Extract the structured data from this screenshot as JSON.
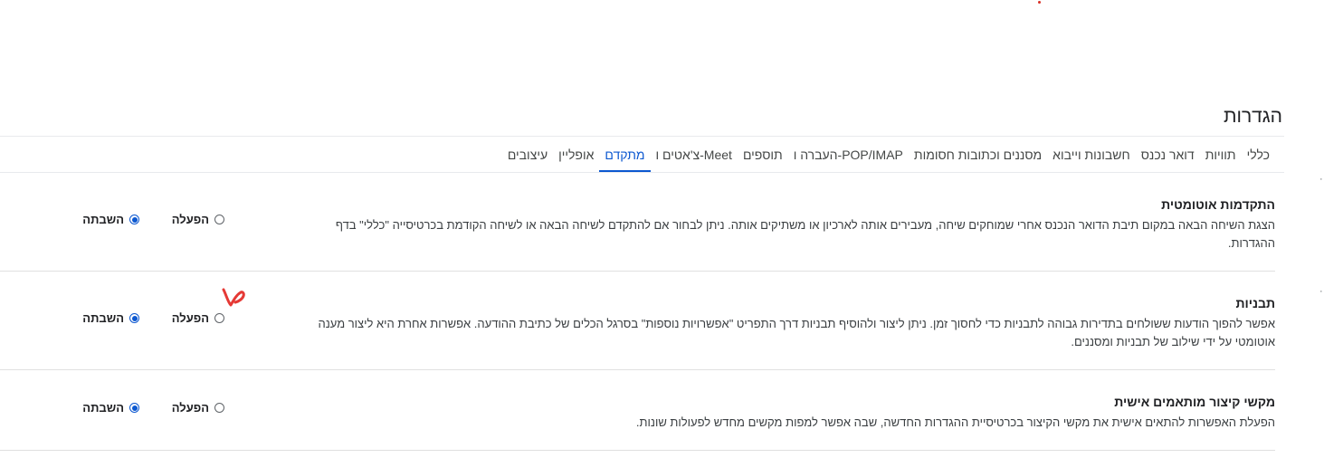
{
  "page": {
    "title": "הגדרות"
  },
  "tabs": [
    {
      "label": "כללי",
      "selected": false
    },
    {
      "label": "תוויות",
      "selected": false
    },
    {
      "label": "דואר נכנס",
      "selected": false
    },
    {
      "label": "חשבונות וייבוא",
      "selected": false
    },
    {
      "label": "מסננים וכתובות חסומות",
      "selected": false
    },
    {
      "label": "העברה ו-POP/IMAP",
      "selected": false
    },
    {
      "label": "תוספים",
      "selected": false
    },
    {
      "label": "צ'אטים ו-Meet",
      "selected": false
    },
    {
      "label": "מתקדם",
      "selected": true
    },
    {
      "label": "אופליין",
      "selected": false
    },
    {
      "label": "עיצובים",
      "selected": false
    }
  ],
  "settings": [
    {
      "title": "התקדמות אוטומטית",
      "description": "הצגת השיחה הבאה במקום תיבת הדואר הנכנס אחרי שמוחקים שיחה, מעבירים אותה לארכיון או משתיקים אותה. ניתן לבחור אם להתקדם לשיחה הבאה או לשיחה הקודמת בכרטיסייה \"כללי\" בדף ההגדרות.",
      "enable_label": "הפעלה",
      "disable_label": "השבתה",
      "selected": "disable"
    },
    {
      "title": "תבניות",
      "description": "אפשר להפוך הודעות ששולחים בתדירות גבוהה לתבניות כדי לחסוך זמן. ניתן ליצור ולהוסיף תבניות דרך התפריט \"אפשרויות נוספות\" בסרגל הכלים של כתיבת ההודעה. אפשרות אחרת היא ליצור מענה אוטומטי על ידי שילוב של תבניות ומסננים.",
      "enable_label": "הפעלה",
      "disable_label": "השבתה",
      "selected": "disable"
    },
    {
      "title": "מקשי קיצור מותאמים אישית",
      "description": "הפעלת האפשרות להתאים אישית את מקשי הקיצור בכרטיסיית ההגדרות החדשה, שבה אפשר למפות מקשים מחדש לפעולות שונות.",
      "enable_label": "הפעלה",
      "disable_label": "השבתה",
      "selected": "disable"
    }
  ],
  "colors": {
    "accent": "#0b57d0",
    "annotation": "#e53935"
  }
}
